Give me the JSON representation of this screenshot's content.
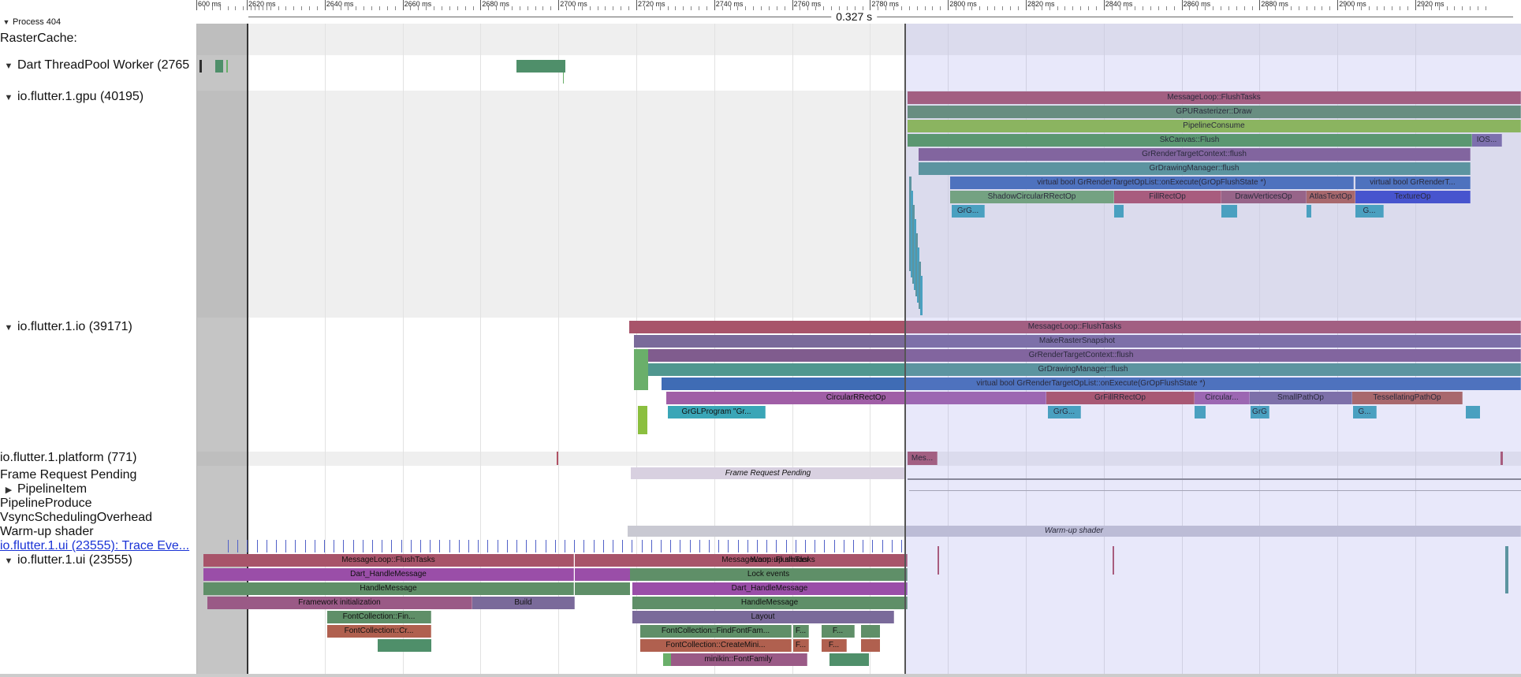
{
  "process": {
    "title": "Process 404"
  },
  "duration": {
    "label": "0.327 s"
  },
  "ruler": {
    "ticks": [
      "600 ms",
      "2620 ms",
      "2640 ms",
      "2660 ms",
      "2680 ms",
      "2700 ms",
      "2720 ms",
      "2740 ms",
      "2760 ms",
      "2780 ms",
      "2800 ms",
      "2820 ms",
      "2840 ms",
      "2860 ms",
      "2880 ms",
      "2900 ms",
      "2920 ms"
    ]
  },
  "tracks": [
    {
      "label": "RasterCache:",
      "arrow": ""
    },
    {
      "label": "Dart ThreadPool Worker (2765",
      "arrow": "down"
    },
    {
      "label": "io.flutter.1.gpu (40195)",
      "arrow": "down"
    },
    {
      "label": "io.flutter.1.io (39171)",
      "arrow": "down"
    },
    {
      "label": "io.flutter.1.platform (771)",
      "arrow": ""
    },
    {
      "label": "Frame Request Pending",
      "arrow": ""
    },
    {
      "label": "PipelineItem",
      "arrow": "right"
    },
    {
      "label": "PipelineProduce",
      "arrow": ""
    },
    {
      "label": "VsyncSchedulingOverhead",
      "arrow": ""
    },
    {
      "label": "Warm-up shader",
      "arrow": ""
    },
    {
      "label": "io.flutter.1.ui (23555): Trace Eve...",
      "arrow": "",
      "link": true
    },
    {
      "label": "io.flutter.1.ui (23555)",
      "arrow": "down"
    }
  ],
  "slices": {
    "gpu": [
      {
        "name": "MessageLoop::FlushTasks",
        "color": "#a8546a"
      },
      {
        "name": "GPURasterizer::Draw",
        "color": "#5f8f68"
      },
      {
        "name": "PipelineConsume",
        "color": "#8bbf3f"
      },
      {
        "name": "SkCanvas::Flush",
        "color": "#4f9a54"
      },
      {
        "name": "IOS...",
        "color": "#7a6aa0"
      },
      {
        "name": "GrRenderTargetContext::flush",
        "color": "#805c8e"
      },
      {
        "name": "GrDrawingManager::flush",
        "color": "#50978f"
      },
      {
        "name": "virtual bool GrRenderTargetOpList::onExecute(GrOpFlushState *)",
        "color": "#3f6cb5"
      },
      {
        "name": "virtual bool GrRenderT...",
        "color": "#3f6cb5"
      },
      {
        "name": "ShadowCircularRRectOp",
        "color": "#6fa86a"
      },
      {
        "name": "FillRectOp",
        "color": "#b05164"
      },
      {
        "name": "DrawVerticesOp",
        "color": "#9a5a72"
      },
      {
        "name": "AtlasTextOp",
        "color": "#b0604f"
      },
      {
        "name": "TextureOp",
        "color": "#3646c8"
      },
      {
        "name": "GrG...",
        "color": "#3aa6b7"
      },
      {
        "name": "G...",
        "color": "#3aa6b7"
      }
    ],
    "io": [
      {
        "name": "MessageLoop::FlushTasks",
        "color": "#a8546a"
      },
      {
        "name": "MakeRasterSnapshot",
        "color": "#7a6a9a"
      },
      {
        "name": "GrRenderTargetContext::flush",
        "color": "#805c8e"
      },
      {
        "name": "GrDrawingManager::flush",
        "color": "#50978f"
      },
      {
        "name": "virtual bool GrRenderTargetOpList::onExecute(GrOpFlushState *)",
        "color": "#3f6cb5"
      },
      {
        "name": "CircularRRectOp",
        "color": "#a05ea6"
      },
      {
        "name": "GrFillRRectOp",
        "color": "#b04c58"
      },
      {
        "name": "Circular...",
        "color": "#a05ea6"
      },
      {
        "name": "SmallPathOp",
        "color": "#7a6a9a"
      },
      {
        "name": "TessellatingPathOp",
        "color": "#b0604f"
      },
      {
        "name": "GrGLProgram \"Gr...",
        "color": "#3aa6b7"
      },
      {
        "name": "GrG...",
        "color": "#3aa6b7"
      },
      {
        "name": "GrG",
        "color": "#3aa6b7"
      },
      {
        "name": "G...",
        "color": "#3aa6b7"
      }
    ],
    "platform": [
      {
        "name": "Mes...",
        "color": "#a8546a"
      }
    ],
    "frame": [
      {
        "name": "Frame Request Pending",
        "color": "#d8d0e0"
      }
    ],
    "warmup": [
      {
        "name": "Warm-up shader",
        "color": "#c9c9d2"
      }
    ],
    "ui": [
      {
        "name": "MessageLoop::FlushTasks",
        "color": "#a8546a"
      },
      {
        "name": "Dart_HandleMessage",
        "color": "#9a4ea8"
      },
      {
        "name": "HandleMessage",
        "color": "#5f8f68"
      },
      {
        "name": "Framework initialization",
        "color": "#9a5a86"
      },
      {
        "name": "Build",
        "color": "#7a6a9a"
      },
      {
        "name": "FontCollection::Fin...",
        "color": "#5f8f68"
      },
      {
        "name": "FontCollection::Cr...",
        "color": "#b0604f"
      },
      {
        "name": "MessageLoop::FlushTasks",
        "color": "#a8546a"
      },
      {
        "name": "Warm-up shader",
        "color": "#a8546a"
      },
      {
        "name": "Lock events",
        "color": "#5f8f68"
      },
      {
        "name": "Dart_HandleMessage",
        "color": "#9a4ea8"
      },
      {
        "name": "HandleMessage",
        "color": "#5f8f68"
      },
      {
        "name": "Layout",
        "color": "#7a6a9a"
      },
      {
        "name": "FontCollection::FindFontFam...",
        "color": "#5f8f68"
      },
      {
        "name": "F...",
        "color": "#5f8f68"
      },
      {
        "name": "F...",
        "color": "#5f8f68"
      },
      {
        "name": "FontCollection::CreateMini...",
        "color": "#b0604f"
      },
      {
        "name": "F...",
        "color": "#b0604f"
      },
      {
        "name": "F...",
        "color": "#b0604f"
      },
      {
        "name": "minikin::FontFamily",
        "color": "#9a5a86"
      }
    ]
  }
}
